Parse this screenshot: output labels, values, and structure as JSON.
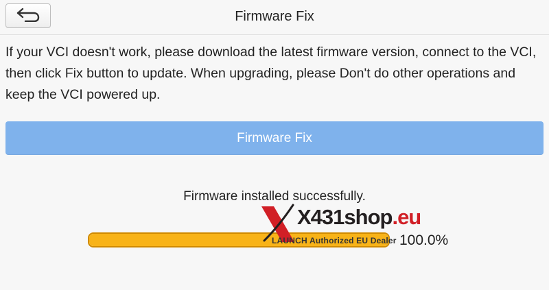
{
  "header": {
    "back_icon": "back-arrow-icon",
    "title": "Firmware Fix"
  },
  "main": {
    "description": "If your VCI doesn't work, please download the latest firmware version, connect to the VCI, then click Fix button to update. When upgrading, please Don't do other operations and keep the VCI powered up.",
    "fix_button_label": "Firmware Fix",
    "status_text": "Firmware installed successfully.",
    "progress": {
      "value": 1.0,
      "label": "100.0%"
    }
  },
  "watermark": {
    "brand_main": "X431shop",
    "brand_tld": ".eu",
    "subtitle": "LAUNCH Authorized EU Dealer"
  },
  "colors": {
    "button": "#7fb2ec",
    "progress_fill": "#f8b318",
    "progress_border": "#d08a00",
    "watermark_red": "#d11f26"
  }
}
